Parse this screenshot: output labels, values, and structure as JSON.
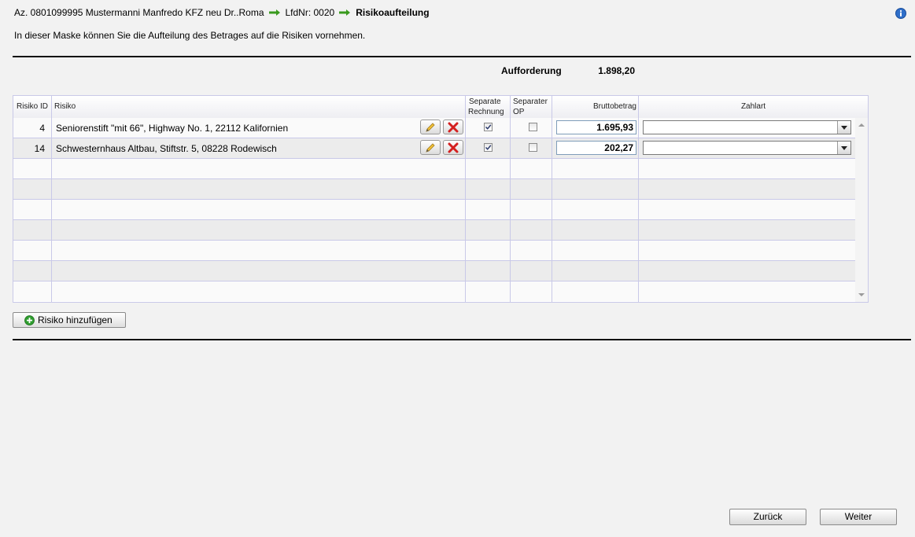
{
  "breadcrumb": {
    "case": "Az. 0801099995 Mustermanni Manfredo KFZ neu Dr..Roma",
    "entry": "LfdNr: 0020",
    "current": "Risikoaufteilung"
  },
  "intro_text": "In dieser Maske können Sie die Aufteilung des Betrages auf die Risiken vornehmen.",
  "summary": {
    "label": "Aufforderung",
    "value": "1.898,20"
  },
  "grid": {
    "columns": {
      "risk_id": "Risiko ID",
      "risk": "Risiko",
      "separate_invoice_1": "Separate",
      "separate_invoice_2": "Rechnung",
      "separate_op_1": "Separater",
      "separate_op_2": "OP",
      "gross_amount": "Bruttobetrag",
      "payment_type": "Zahlart"
    },
    "rows": [
      {
        "id": "4",
        "risk": "Seniorenstift \"mit 66\", Highway No. 1, 22112 Kalifornien",
        "separate_invoice": true,
        "separate_op": false,
        "amount": "1.695,93",
        "payment_type": ""
      },
      {
        "id": "14",
        "risk": "Schwesternhaus Altbau, Stiftstr. 5, 08228 Rodewisch",
        "separate_invoice": true,
        "separate_op": false,
        "amount": "202,27",
        "payment_type": ""
      }
    ]
  },
  "buttons": {
    "add_risk": "Risiko hinzufügen",
    "back": "Zurück",
    "next": "Weiter"
  },
  "icons": {
    "arrow": "arrow-right-icon",
    "info": "info-icon",
    "edit": "pencil-icon",
    "delete": "close-icon",
    "add": "plus-circle-icon"
  },
  "colors": {
    "arrow_green": "#3a9a1e",
    "delete_red": "#d42020",
    "info_blue": "#2f6fc9",
    "add_green": "#2e9d2e"
  }
}
